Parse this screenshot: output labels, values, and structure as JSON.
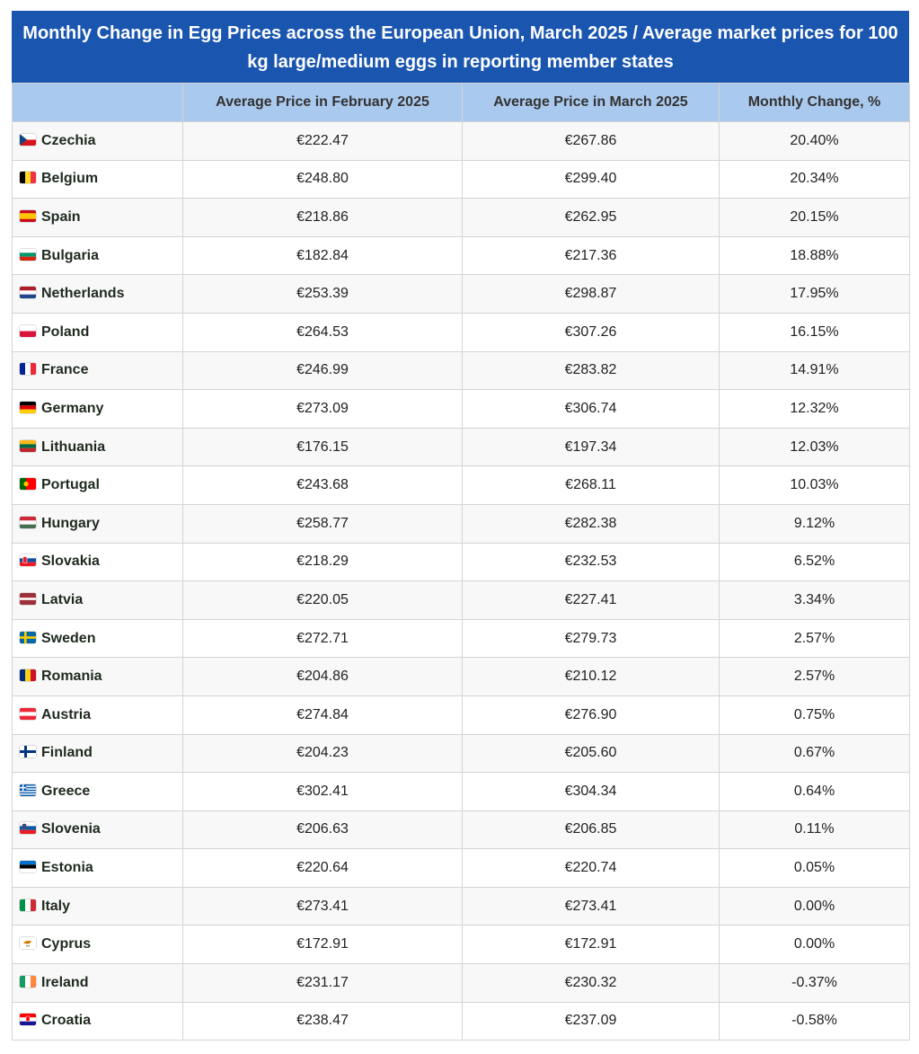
{
  "chart_data": {
    "type": "table",
    "title": "Monthly Change in Egg Prices across the European Union, March 2025 / Average market prices for 100 kg large/medium eggs in reporting member states",
    "columns": [
      "",
      "Average Price in February 2025",
      "Average Price in March 2025",
      "Monthly Change, %"
    ],
    "rows": [
      {
        "country": "Czechia",
        "flag_icon": "czechia-flag-icon",
        "feb": "€222.47",
        "mar": "€267.86",
        "change": "20.40%"
      },
      {
        "country": "Belgium",
        "flag_icon": "belgium-flag-icon",
        "feb": "€248.80",
        "mar": "€299.40",
        "change": "20.34%"
      },
      {
        "country": "Spain",
        "flag_icon": "spain-flag-icon",
        "feb": "€218.86",
        "mar": "€262.95",
        "change": "20.15%"
      },
      {
        "country": "Bulgaria",
        "flag_icon": "bulgaria-flag-icon",
        "feb": "€182.84",
        "mar": "€217.36",
        "change": "18.88%"
      },
      {
        "country": "Netherlands",
        "flag_icon": "netherlands-flag-icon",
        "feb": "€253.39",
        "mar": "€298.87",
        "change": "17.95%"
      },
      {
        "country": "Poland",
        "flag_icon": "poland-flag-icon",
        "feb": "€264.53",
        "mar": "€307.26",
        "change": "16.15%"
      },
      {
        "country": "France",
        "flag_icon": "france-flag-icon",
        "feb": "€246.99",
        "mar": "€283.82",
        "change": "14.91%"
      },
      {
        "country": "Germany",
        "flag_icon": "germany-flag-icon",
        "feb": "€273.09",
        "mar": "€306.74",
        "change": "12.32%"
      },
      {
        "country": "Lithuania",
        "flag_icon": "lithuania-flag-icon",
        "feb": "€176.15",
        "mar": "€197.34",
        "change": "12.03%"
      },
      {
        "country": "Portugal",
        "flag_icon": "portugal-flag-icon",
        "feb": "€243.68",
        "mar": "€268.11",
        "change": "10.03%"
      },
      {
        "country": "Hungary",
        "flag_icon": "hungary-flag-icon",
        "feb": "€258.77",
        "mar": "€282.38",
        "change": "9.12%"
      },
      {
        "country": "Slovakia",
        "flag_icon": "slovakia-flag-icon",
        "feb": "€218.29",
        "mar": "€232.53",
        "change": "6.52%"
      },
      {
        "country": "Latvia",
        "flag_icon": "latvia-flag-icon",
        "feb": "€220.05",
        "mar": "€227.41",
        "change": "3.34%"
      },
      {
        "country": "Sweden",
        "flag_icon": "sweden-flag-icon",
        "feb": "€272.71",
        "mar": "€279.73",
        "change": "2.57%"
      },
      {
        "country": "Romania",
        "flag_icon": "romania-flag-icon",
        "feb": "€204.86",
        "mar": "€210.12",
        "change": "2.57%"
      },
      {
        "country": "Austria",
        "flag_icon": "austria-flag-icon",
        "feb": "€274.84",
        "mar": "€276.90",
        "change": "0.75%"
      },
      {
        "country": "Finland",
        "flag_icon": "finland-flag-icon",
        "feb": "€204.23",
        "mar": "€205.60",
        "change": "0.67%"
      },
      {
        "country": "Greece",
        "flag_icon": "greece-flag-icon",
        "feb": "€302.41",
        "mar": "€304.34",
        "change": "0.64%"
      },
      {
        "country": "Slovenia",
        "flag_icon": "slovenia-flag-icon",
        "feb": "€206.63",
        "mar": "€206.85",
        "change": "0.11%"
      },
      {
        "country": "Estonia",
        "flag_icon": "estonia-flag-icon",
        "feb": "€220.64",
        "mar": "€220.74",
        "change": "0.05%"
      },
      {
        "country": "Italy",
        "flag_icon": "italy-flag-icon",
        "feb": "€273.41",
        "mar": "€273.41",
        "change": "0.00%"
      },
      {
        "country": "Cyprus",
        "flag_icon": "cyprus-flag-icon",
        "feb": "€172.91",
        "mar": "€172.91",
        "change": "0.00%"
      },
      {
        "country": "Ireland",
        "flag_icon": "ireland-flag-icon",
        "feb": "€231.17",
        "mar": "€230.32",
        "change": "-0.37%"
      },
      {
        "country": "Croatia",
        "flag_icon": "croatia-flag-icon",
        "feb": "€238.47",
        "mar": "€237.09",
        "change": "-0.58%"
      }
    ]
  },
  "colors": {
    "title_bg": "#1a56b0",
    "header_bg": "#aac9ee",
    "row_alt_bg": "#f8f8f8",
    "border": "#d4d4d4"
  }
}
